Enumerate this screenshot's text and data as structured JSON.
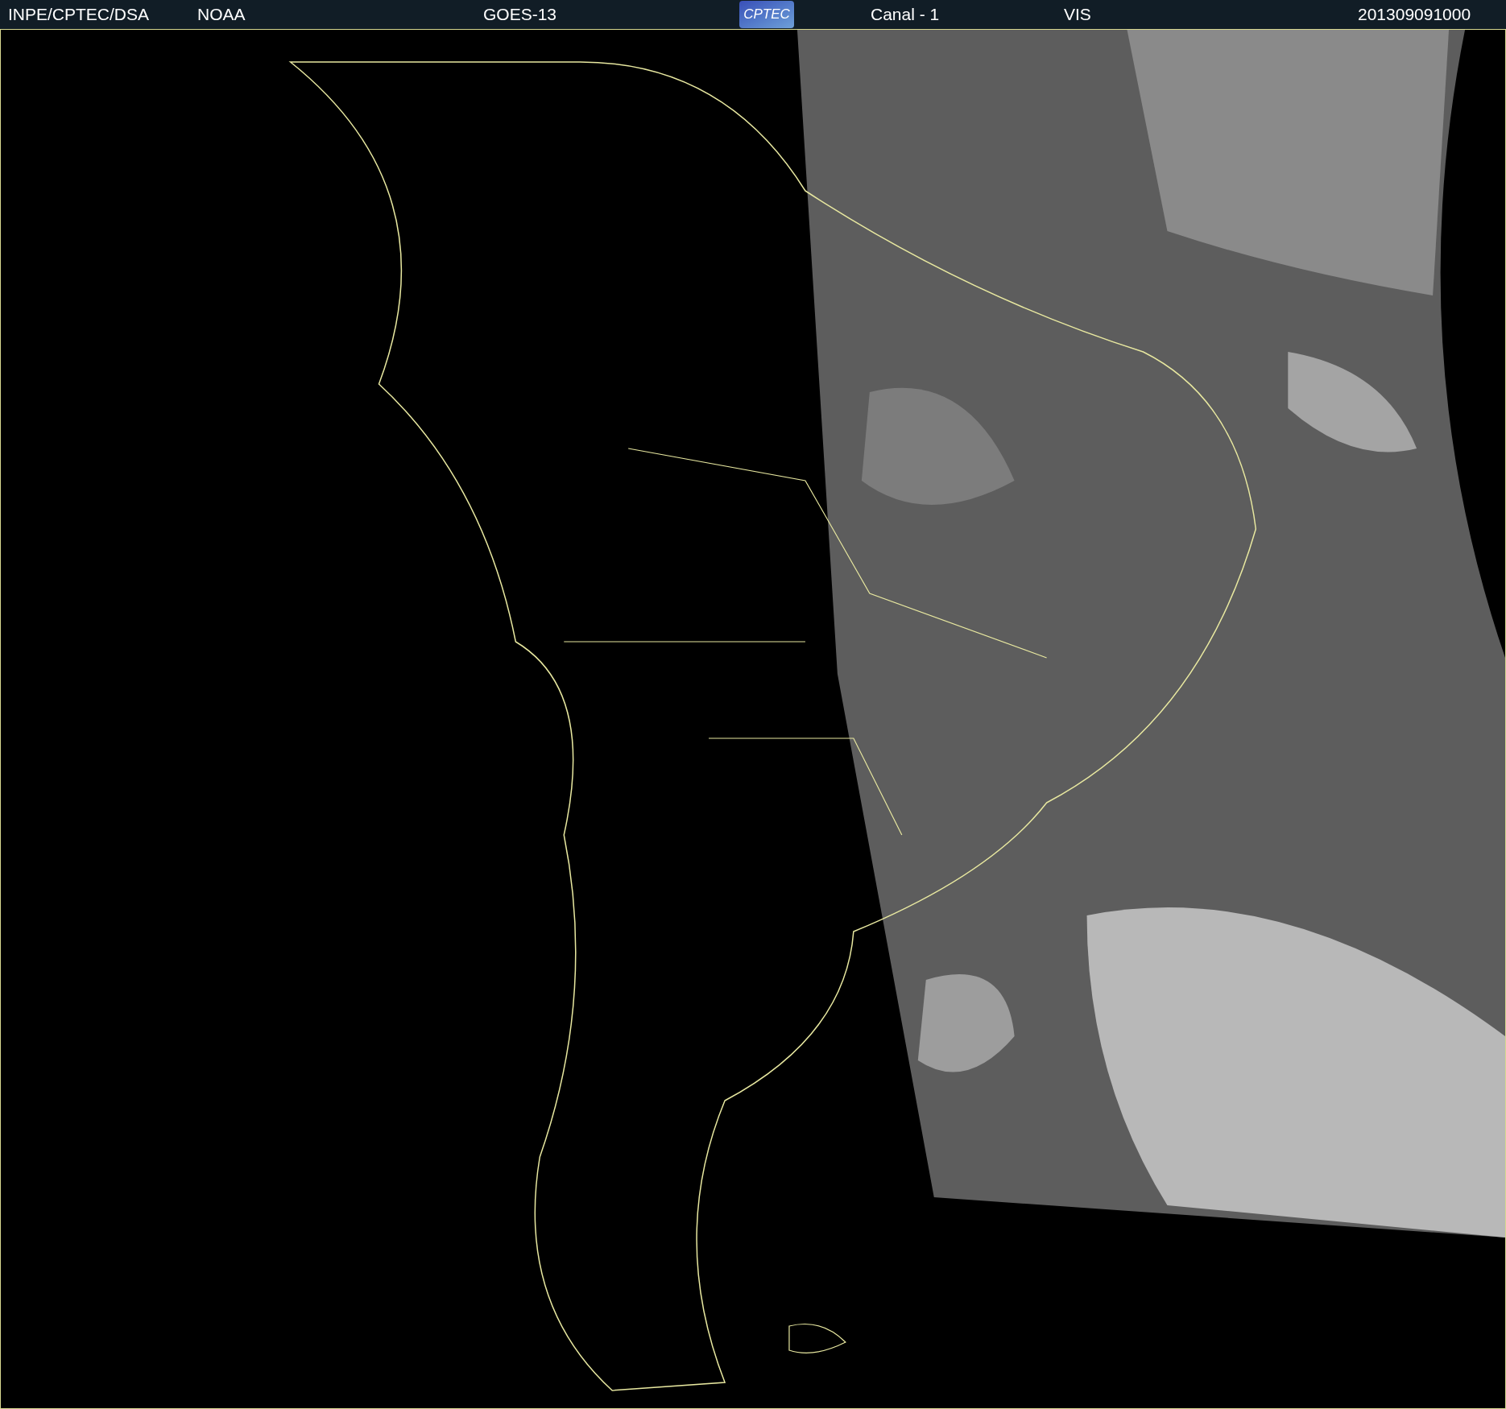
{
  "header": {
    "institute": "INPE/CPTEC/DSA",
    "agency": "NOAA",
    "satellite": "GOES-13",
    "logo": "CPTEC",
    "channel": "Canal - 1",
    "band": "VIS",
    "timestamp": "201309091000"
  }
}
